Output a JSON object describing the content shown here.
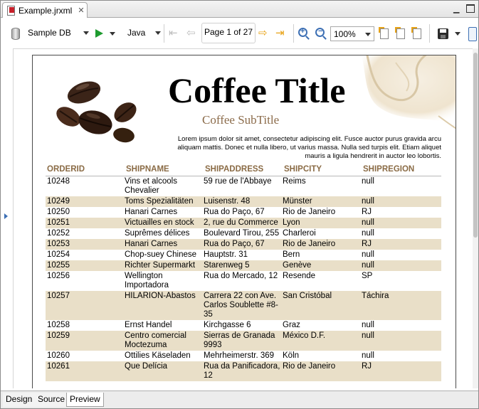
{
  "editor": {
    "tab_title": "Example.jrxml",
    "close_glyph": "✕"
  },
  "toolbar": {
    "datasource": "Sample DB",
    "language": "Java",
    "page_indicator": "Page 1 of 27",
    "zoom": "100%"
  },
  "report": {
    "title": "Coffee Title",
    "subtitle": "Coffee SubTitle",
    "lorem": "Lorem ipsum dolor sit amet, consectetur adipiscing elit. Fusce auctor purus gravida arcu aliquam mattis. Donec et nulla libero, ut varius massa. Nulla sed turpis elit. Etiam aliquet mauris a ligula hendrerit in auctor leo lobortis.",
    "columns": [
      "ORDERID",
      "SHIPNAME",
      "SHIPADDRESS",
      "SHIPCITY",
      "SHIPREGION"
    ],
    "rows": [
      [
        "10248",
        "Vins et alcools Chevalier",
        "59 rue de l'Abbaye",
        "Reims",
        "null"
      ],
      [
        "10249",
        "Toms Spezialitäten",
        "Luisenstr. 48",
        "Münster",
        "null"
      ],
      [
        "10250",
        "Hanari Carnes",
        "Rua do Paço, 67",
        "Rio de Janeiro",
        "RJ"
      ],
      [
        "10251",
        "Victuailles en stock",
        "2, rue du Commerce",
        "Lyon",
        "null"
      ],
      [
        "10252",
        "Suprêmes délices",
        "Boulevard Tirou, 255",
        "Charleroi",
        "null"
      ],
      [
        "10253",
        "Hanari Carnes",
        "Rua do Paço, 67",
        "Rio de Janeiro",
        "RJ"
      ],
      [
        "10254",
        "Chop-suey Chinese",
        "Hauptstr. 31",
        "Bern",
        "null"
      ],
      [
        "10255",
        "Richter Supermarkt",
        "Starenweg 5",
        "Genève",
        "null"
      ],
      [
        "10256",
        "Wellington Importadora",
        "Rua do Mercado, 12",
        "Resende",
        "SP"
      ],
      [
        "10257",
        "HILARION-Abastos",
        "Carrera 22 con Ave. Carlos Soublette #8-35",
        "San Cristóbal",
        "Táchira"
      ],
      [
        "10258",
        "Ernst Handel",
        "Kirchgasse 6",
        "Graz",
        "null"
      ],
      [
        "10259",
        "Centro comercial Moctezuma",
        "Sierras de Granada 9993",
        "México D.F.",
        "null"
      ],
      [
        "10260",
        "Ottilies Käseladen",
        "Mehrheimerstr. 369",
        "Köln",
        "null"
      ],
      [
        "10261",
        "Que Delícia",
        "Rua da Panificadora, 12",
        "Rio de Janeiro",
        "RJ"
      ]
    ]
  },
  "bottom_tabs": [
    "Design",
    "Source",
    "Preview"
  ],
  "colors": {
    "header_text": "#8a6b45",
    "row_band": "#e9dfc8",
    "play_green": "#1e9b2f",
    "nav_orange": "#e8a317"
  }
}
